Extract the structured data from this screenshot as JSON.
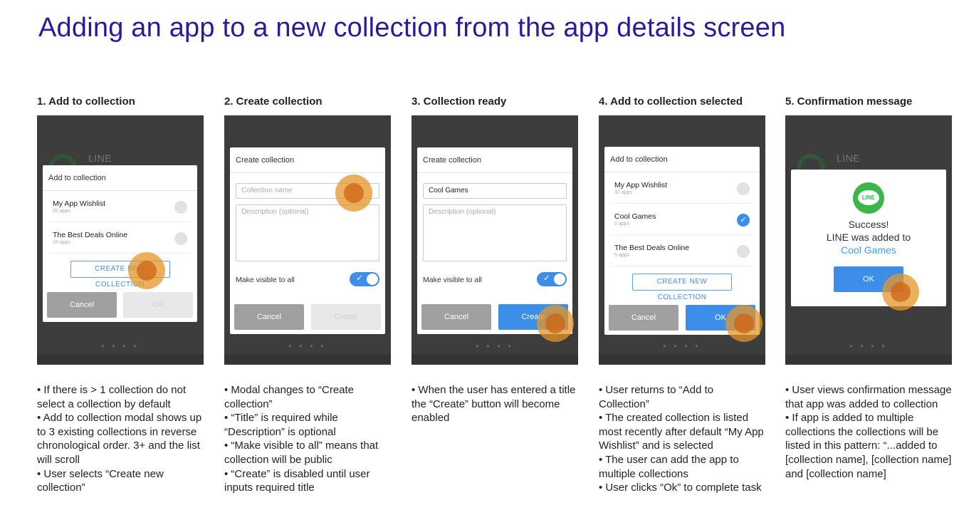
{
  "page_title": "Adding an app to a new collection from the app details screen",
  "background_app": {
    "name": "LINE"
  },
  "steps": [
    {
      "title": "1. Add to collection",
      "modal": {
        "title": "Add to collection",
        "items": [
          {
            "name": "My App Wishlist",
            "count": "32 apps"
          },
          {
            "name": "The Best Deals Online",
            "count": "15 apps"
          }
        ],
        "create_new": "CREATE NEW COLLECTION",
        "cancel": "Cancel",
        "ok": "OK"
      },
      "notes": [
        "• If there is > 1 collection do not select a collection by default",
        "• Add to collection modal shows up to 3 existing collections in reverse chronological order. 3+ and the list will scroll",
        "• User selects “Create new collection”"
      ]
    },
    {
      "title": "2. Create collection",
      "modal": {
        "title": "Create collection",
        "name_placeholder": "Collection name",
        "desc_placeholder": "Description (optional)",
        "visible_label": "Make visible to all",
        "cancel": "Cancel",
        "create": "Create"
      },
      "notes": [
        "• Modal changes to “Create collection”",
        "• “Title” is required while “Description” is optional",
        "• “Make visible to all” means that collection will be public",
        "• “Create” is disabled until user inputs required title"
      ]
    },
    {
      "title": "3. Collection ready",
      "modal": {
        "title": "Create collection",
        "name_value": "Cool Games",
        "desc_placeholder": "Description (optional)",
        "visible_label": "Make visible to all",
        "cancel": "Cancel",
        "create": "Create"
      },
      "notes": [
        "• When the user has entered a title the “Create” button will become enabled"
      ]
    },
    {
      "title": "4. Add to collection selected",
      "modal": {
        "title": "Add to collection",
        "items": [
          {
            "name": "My App Wishlist",
            "count": "32 apps",
            "checked": false
          },
          {
            "name": "Cool Games",
            "count": "0 apps",
            "checked": true
          },
          {
            "name": "The Best Deals Online",
            "count": "5 apps",
            "checked": false
          }
        ],
        "create_new": "CREATE NEW COLLECTION",
        "cancel": "Cancel",
        "ok": "OK"
      },
      "notes": [
        "• User returns to “Add to Collection”",
        "• The created collection is listed most recently after default “My App Wishlist” and is selected",
        "•  The user can add the app to multiple collections",
        "• User clicks “Ok” to complete task"
      ]
    },
    {
      "title": "5. Confirmation message",
      "modal": {
        "logo_text": "LINE",
        "line1": "Success!",
        "line2": "LINE was added to",
        "collection": "Cool Games",
        "ok": "OK"
      },
      "notes": [
        "• User views confirmation message that app was added to collection",
        "• If app is added to multiple collections the collections will be listed in this pattern:  “...added to [collection name], [collection name] and [collection name]"
      ]
    }
  ]
}
